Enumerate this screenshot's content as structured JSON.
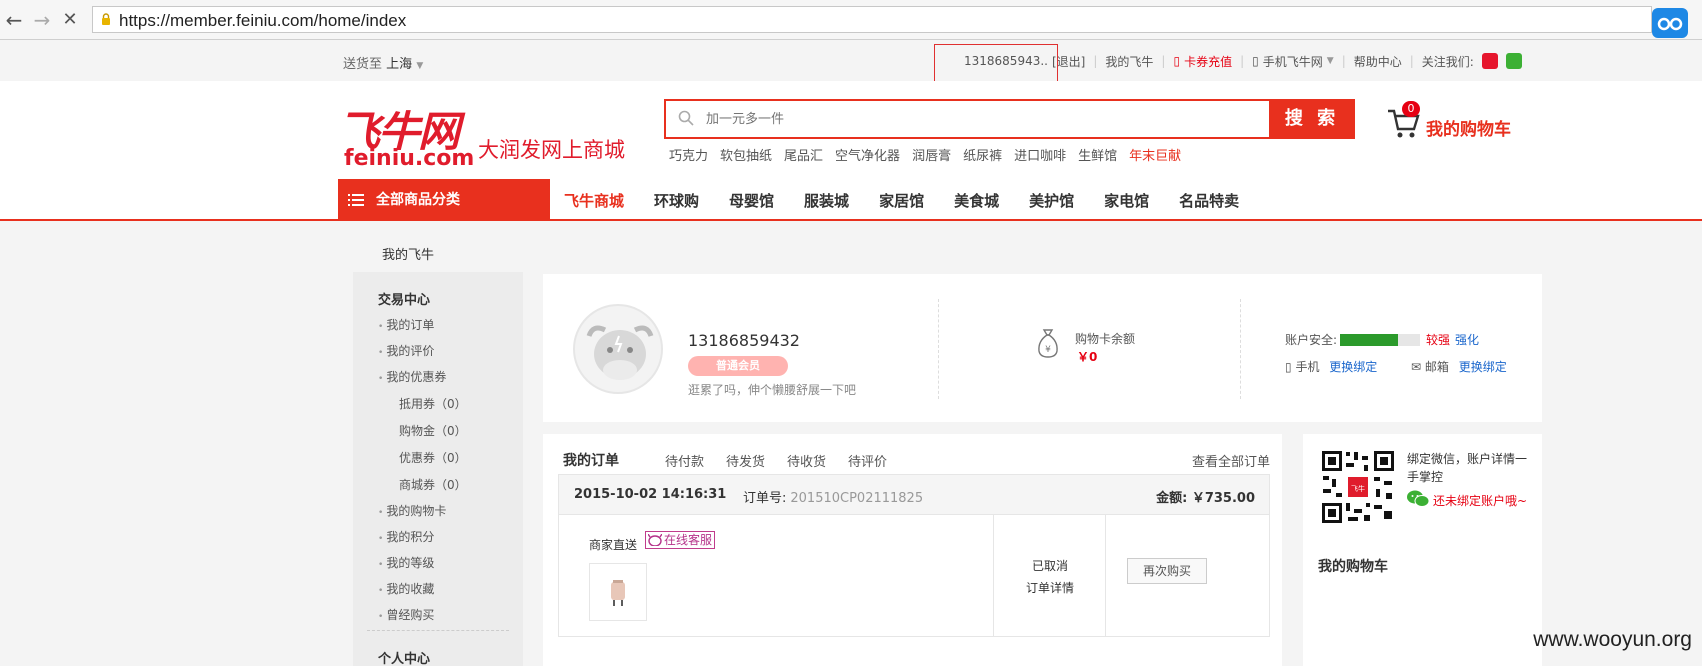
{
  "browser": {
    "url": "https://member.feiniu.com/home/index"
  },
  "topbar": {
    "ship_label": "送货至",
    "ship_city": "上海",
    "user": "1318685943..",
    "logout": "[退出]",
    "my_feiniu": "我的飞牛",
    "recharge": "卡券充值",
    "mobile": "手机飞牛网",
    "help": "帮助中心",
    "follow": "关注我们:"
  },
  "header": {
    "logo_cn": "飞牛网",
    "logo_pinyin": "feiniu.com",
    "slogan": "大润发网上商城",
    "search_placeholder": "加一元多一件",
    "search_button": "搜 索",
    "hotwords": [
      "巧克力",
      "软包抽纸",
      "尾品汇",
      "空气净化器",
      "润唇膏",
      "纸尿裤",
      "进口咖啡",
      "生鲜馆"
    ],
    "hotword_highlight": "年末巨献",
    "cart_count": "0",
    "cart_label": "我的购物车"
  },
  "nav": {
    "all_categories": "全部商品分类",
    "items": [
      "飞牛商城",
      "环球购",
      "母婴馆",
      "服装城",
      "家居馆",
      "美食城",
      "美护馆",
      "家电馆",
      "名品特卖"
    ]
  },
  "breadcrumb": "我的飞牛",
  "sidebar": {
    "trade_title": "交易中心",
    "orders": "我的订单",
    "reviews": "我的评价",
    "coupons": "我的优惠券",
    "coupon_subs": [
      "抵用券（0）",
      "购物金（0）",
      "优惠券（0）",
      "商城券（0）"
    ],
    "cards": "我的购物卡",
    "points": "我的积分",
    "level": "我的等级",
    "favorites": "我的收藏",
    "history": "曾经购买",
    "personal_title": "个人中心"
  },
  "profile": {
    "phone": "13186859432",
    "member_level": "普通会员",
    "motto": "逛累了吗，伸个懒腰舒展一下吧",
    "balance_label": "购物卡余额",
    "balance_value": "￥0",
    "security_label": "账户安全:",
    "security_level": "较强",
    "security_strengthen": "强化",
    "security_fill": 0.72,
    "phone_label": "手机",
    "phone_action": "更换绑定",
    "email_label": "邮箱",
    "email_action": "更换绑定"
  },
  "orders": {
    "title": "我的订单",
    "tabs": [
      "待付款",
      "待发货",
      "待收货",
      "待评价"
    ],
    "view_all": "查看全部订单",
    "order": {
      "time": "2015-10-02 14:16:31",
      "no_label": "订单号:",
      "no": "201510CP02111825",
      "amount_label": "金额:",
      "amount": "￥735.00",
      "seller": "商家直送",
      "customer_service": "在线客服",
      "status": "已取消",
      "detail": "订单详情",
      "rebuy": "再次购买"
    }
  },
  "rightpanel": {
    "wechat_text": "绑定微信，账户详情一手掌控",
    "wechat_link": "还未绑定账户哦~",
    "mycart": "我的购物车"
  },
  "watermark": "www.wooyun.org"
}
